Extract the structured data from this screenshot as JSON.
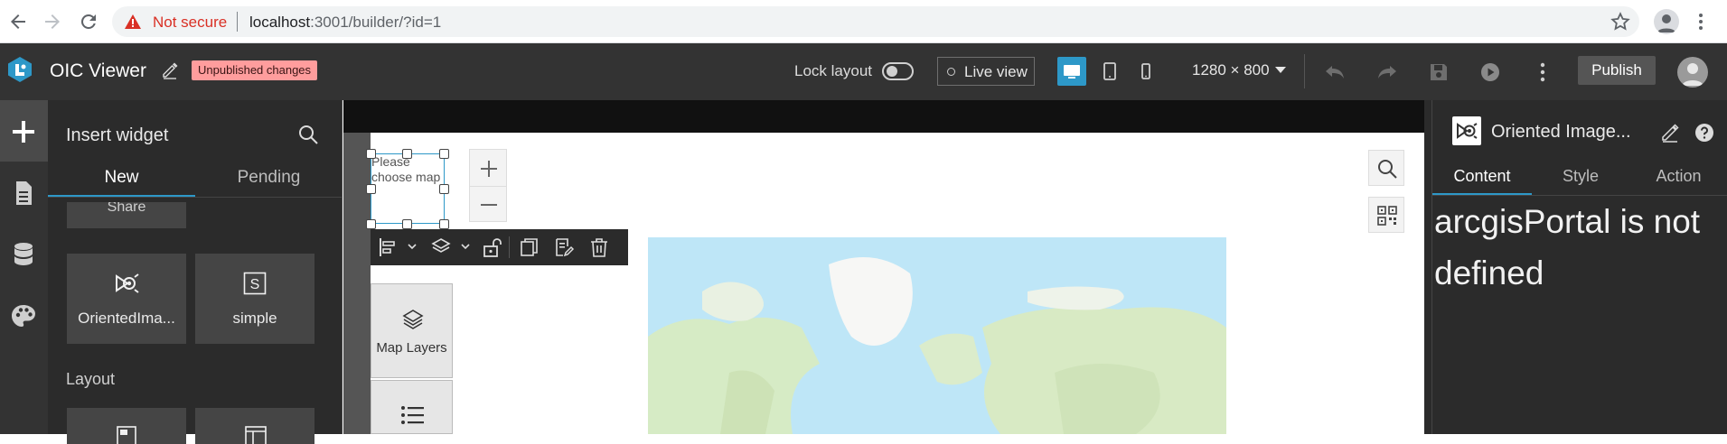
{
  "browser": {
    "security_label": "Not secure",
    "url_host": "localhost",
    "url_path": ":3001/builder/?id=1"
  },
  "header": {
    "app_title": "OIC Viewer",
    "unpublished_badge": "Unpublished changes",
    "lock_layout_label": "Lock layout",
    "lock_layout_on": false,
    "live_view_label": "Live view",
    "resolution": "1280 × 800",
    "publish_label": "Publish",
    "accent_color": "#2d98c8",
    "badge_color": "#ff9d9d"
  },
  "left_rail": {
    "items": [
      {
        "icon": "plus-icon",
        "active": true
      },
      {
        "icon": "page-icon",
        "active": false
      },
      {
        "icon": "database-icon",
        "active": false
      },
      {
        "icon": "palette-icon",
        "active": false
      }
    ]
  },
  "insert_panel": {
    "title": "Insert widget",
    "tabs": [
      {
        "label": "New",
        "active": true
      },
      {
        "label": "Pending",
        "active": false
      }
    ],
    "widgets": [
      {
        "label": "Share",
        "icon": "share-icon"
      },
      {
        "label": "OrientedIma...",
        "icon": "oriented-imagery-icon"
      },
      {
        "label": "simple",
        "icon": "simple-s-icon"
      }
    ],
    "layout_section": "Layout"
  },
  "canvas": {
    "selected_widget_text": "Please choose map",
    "map_layers_label": "Map Layers"
  },
  "settings": {
    "title": "Oriented Image...",
    "tabs": [
      {
        "label": "Content",
        "active": true
      },
      {
        "label": "Style",
        "active": false
      },
      {
        "label": "Action",
        "active": false
      }
    ],
    "error_message": "arcgisPortal is not defined"
  }
}
